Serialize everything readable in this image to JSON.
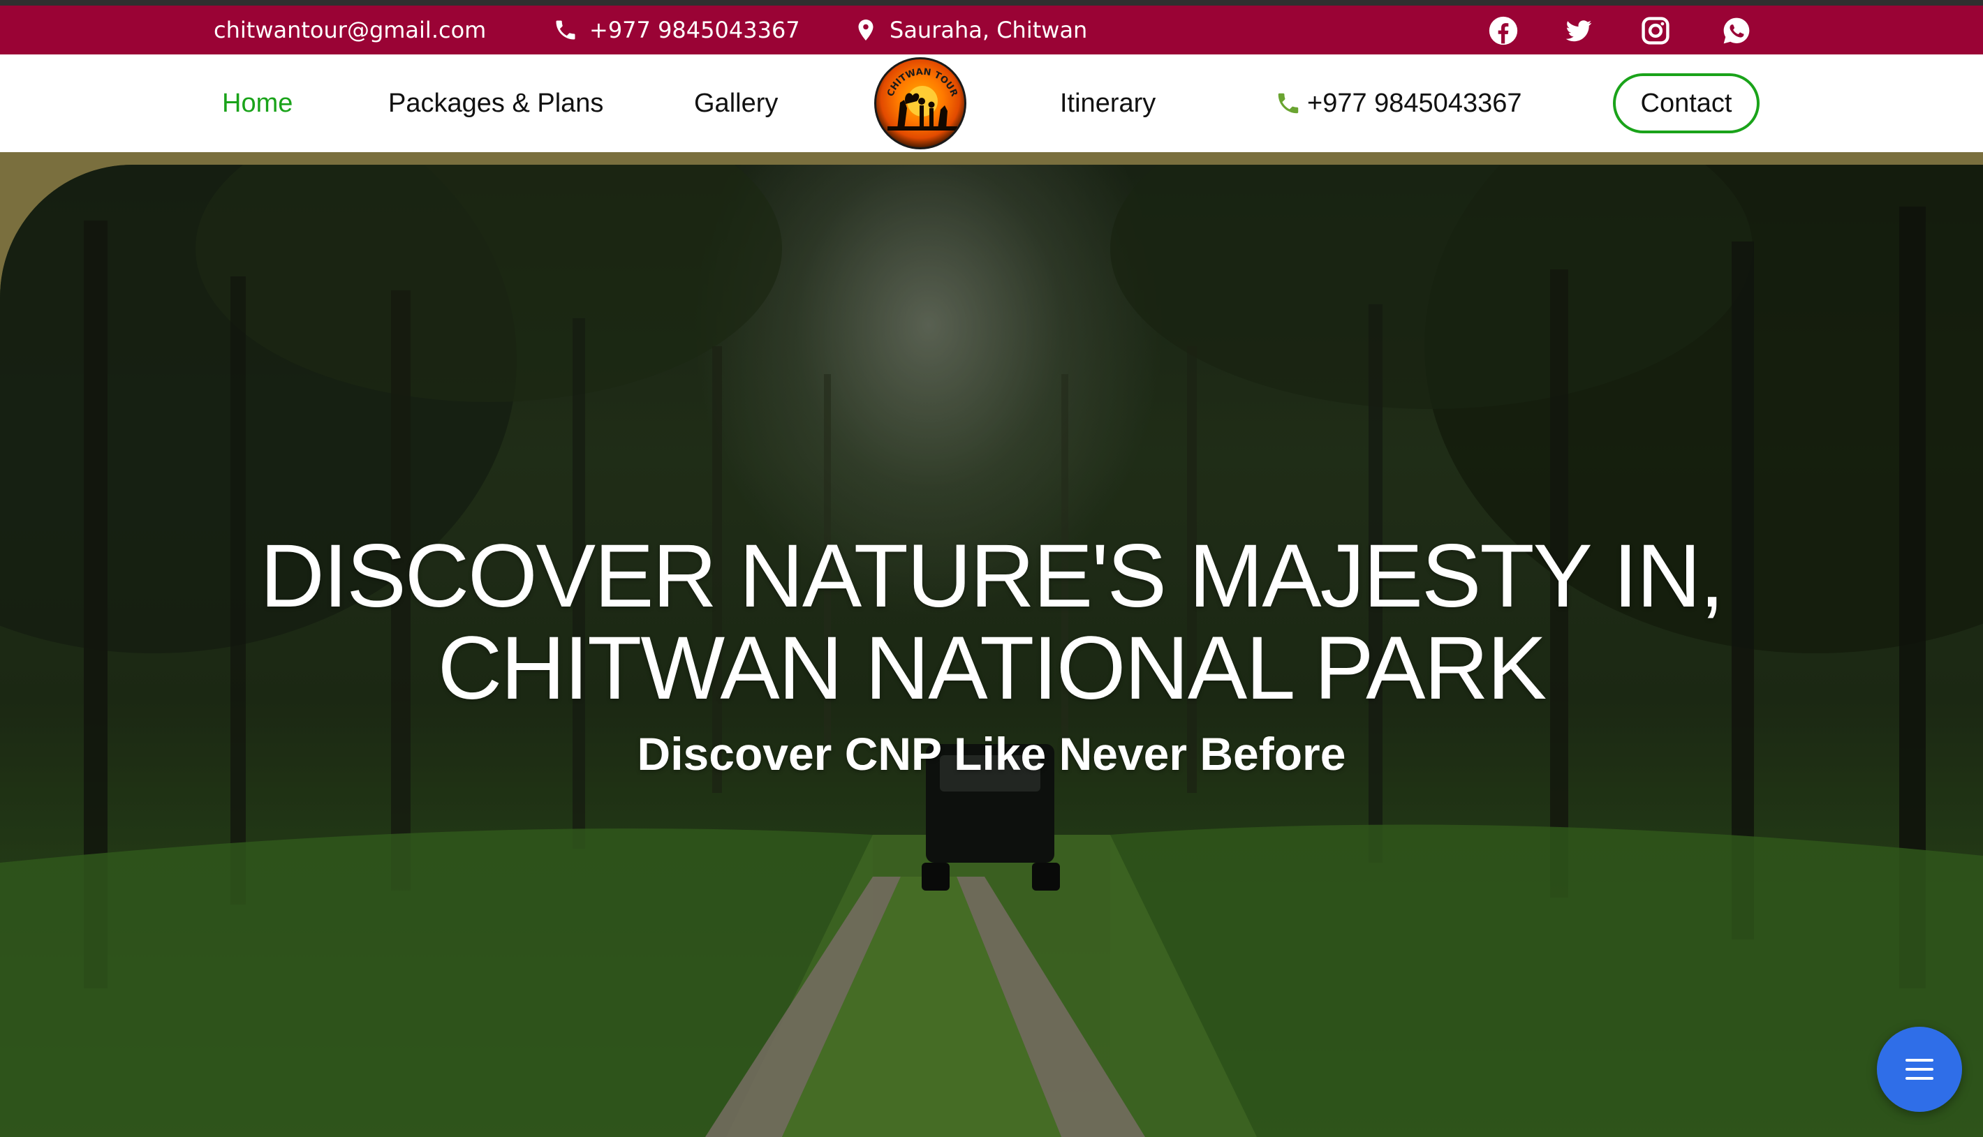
{
  "topbar": {
    "email": "chitwantour@gmail.com",
    "phone": "+977 9845043367",
    "location": "Sauraha, Chitwan",
    "social": [
      "facebook-icon",
      "twitter-icon",
      "instagram-icon",
      "whatsapp-icon"
    ]
  },
  "nav": {
    "home": "Home",
    "packages": "Packages & Plans",
    "gallery": "Gallery",
    "logo_text": "CHITWAN TOUR",
    "itinerary": "Itinerary",
    "phone": "+977 9845043367",
    "contact": "Contact"
  },
  "hero": {
    "title_line1": "DISCOVER NATURE'S MAJESTY IN,",
    "title_line2": "CHITWAN NATIONAL PARK",
    "subtitle": "Discover CNP Like Never Before"
  },
  "fab": {
    "icon": "menu-icon"
  },
  "colors": {
    "topbar_bg": "#9a0335",
    "nav_active": "#1aa31a",
    "contact_border": "#1aa31a",
    "fab_bg": "#2f6ee8",
    "hero_accent": "#7a6f3e"
  }
}
